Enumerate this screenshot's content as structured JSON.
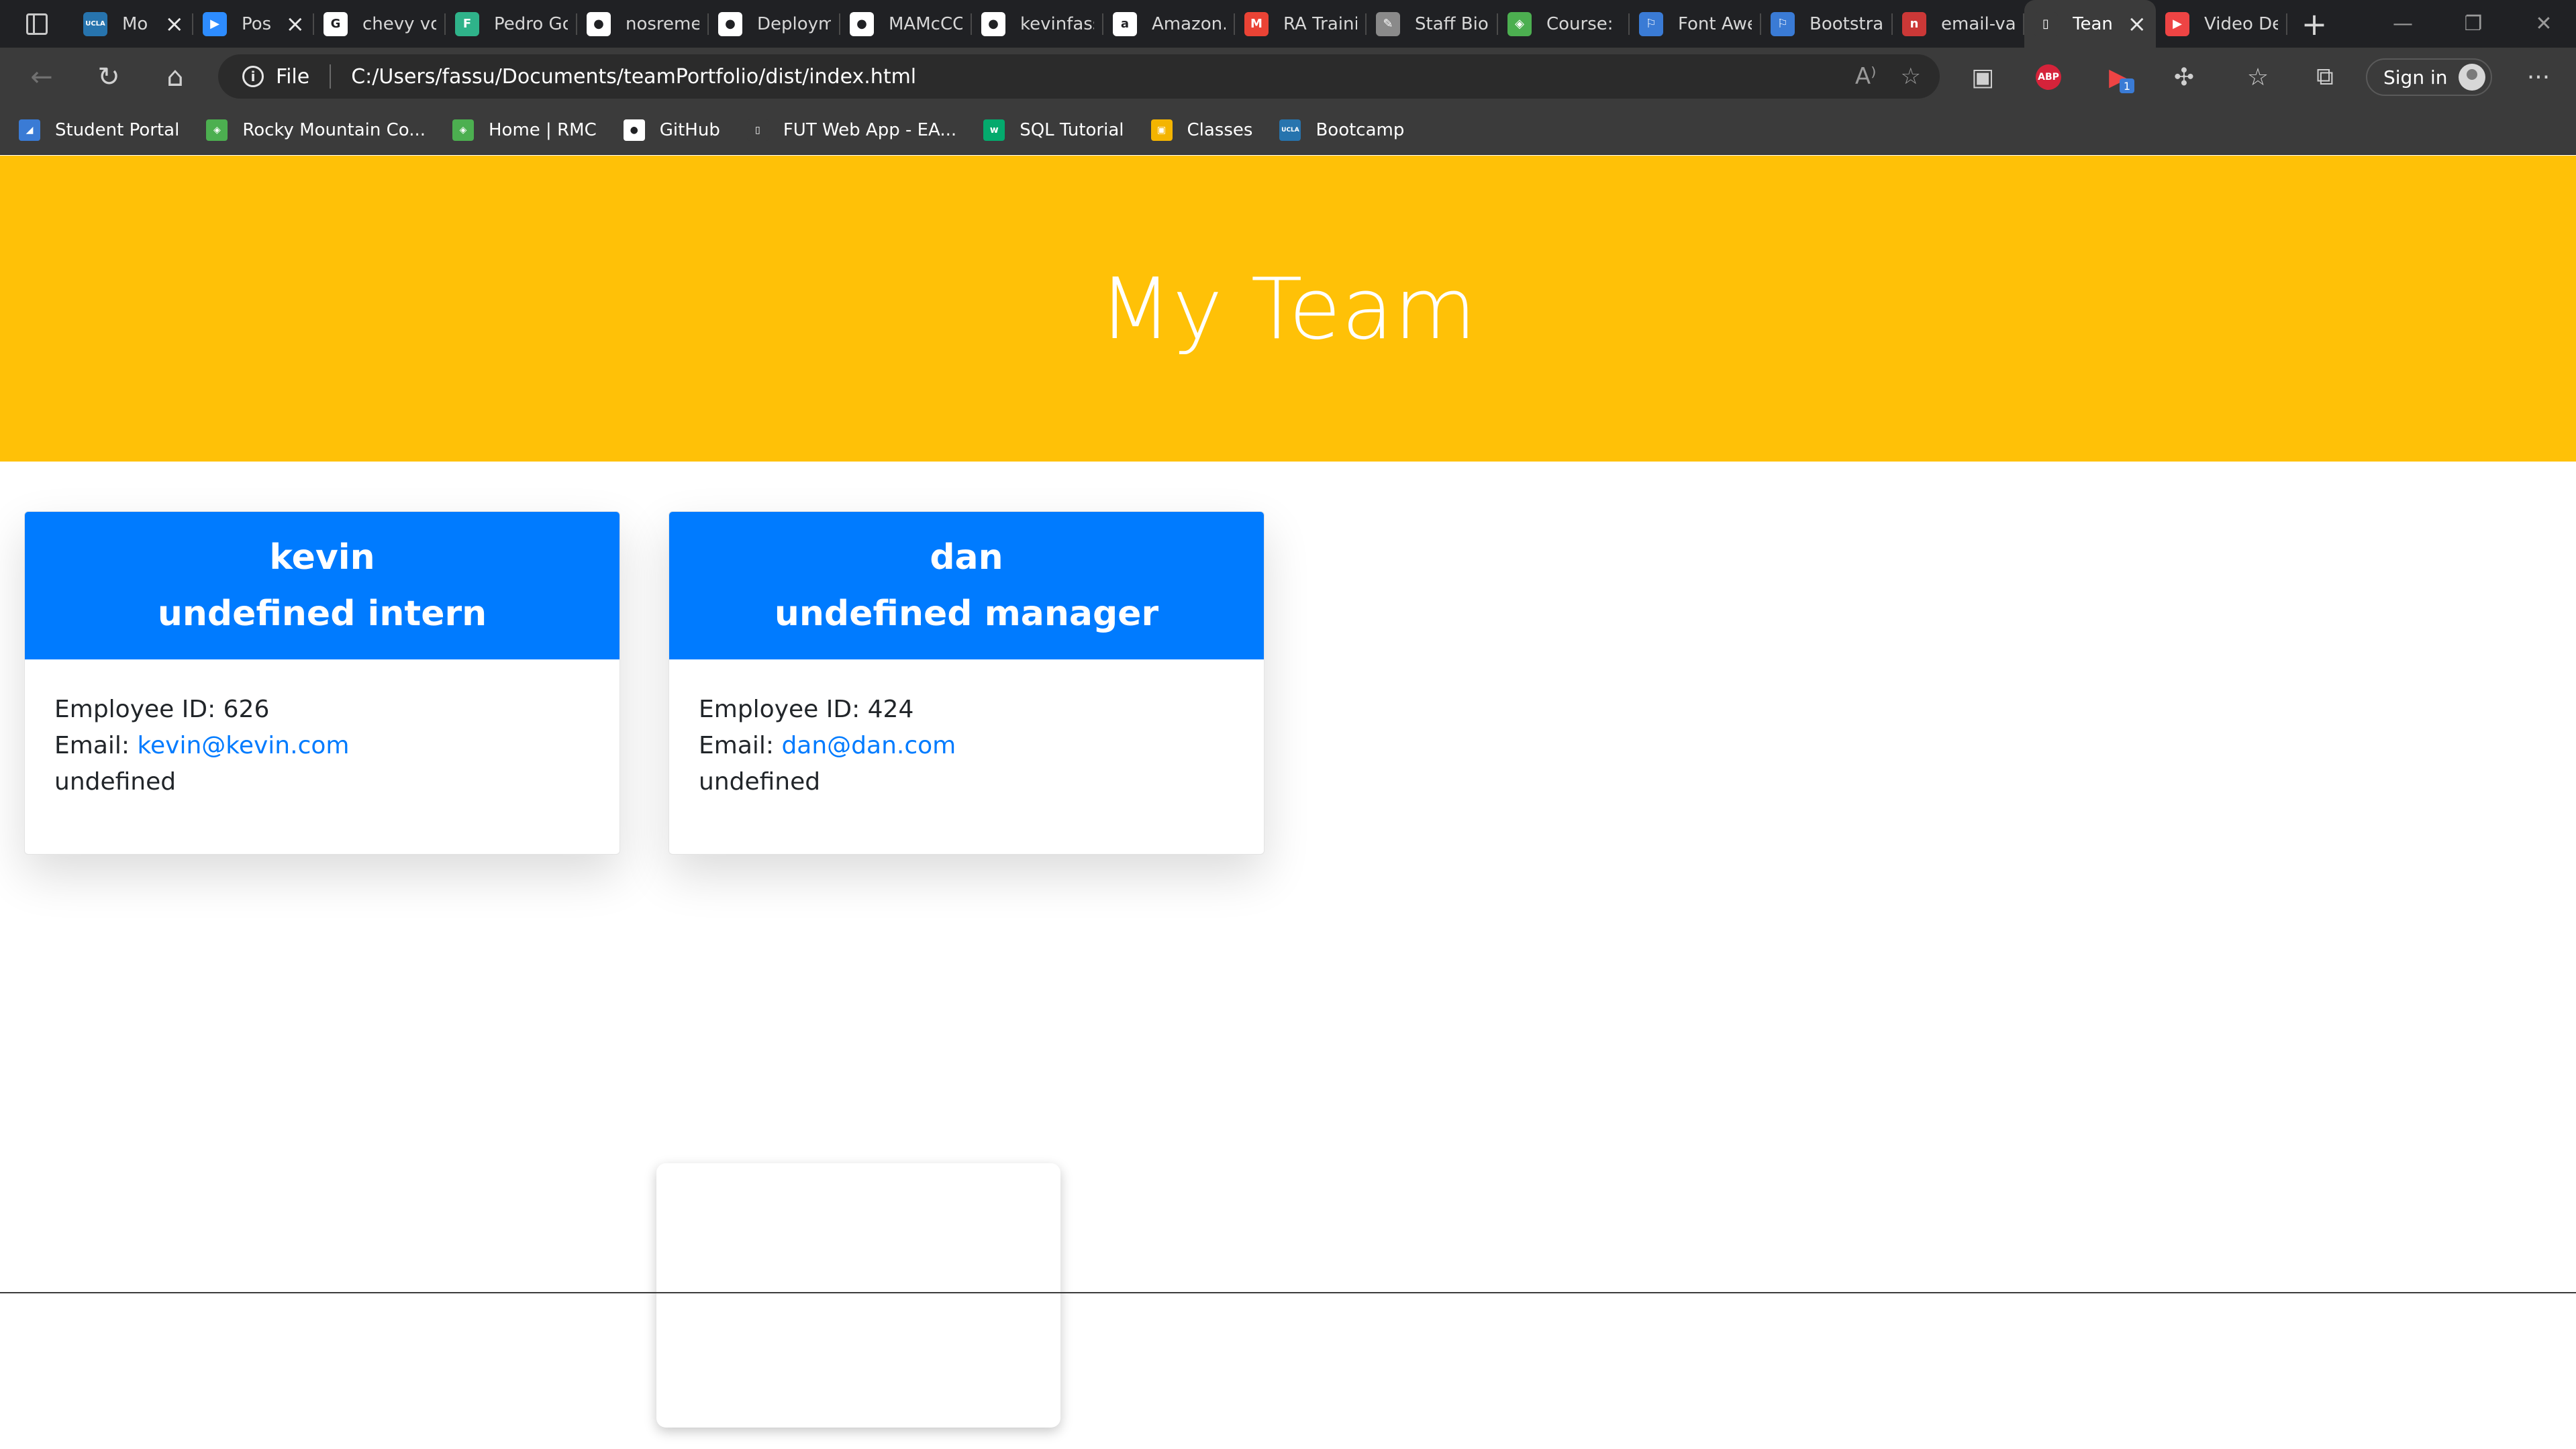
{
  "browser": {
    "tabs": [
      {
        "label": "Mo",
        "favicon": "ucla-icon",
        "color": "#2774ae",
        "glyph": "UCLA",
        "closable": true
      },
      {
        "label": "Pos",
        "favicon": "zoom-icon",
        "color": "#2d8cff",
        "glyph": "▶",
        "closable": true
      },
      {
        "label": "chevy vo",
        "favicon": "google-icon",
        "color": "#ffffff",
        "glyph": "G",
        "closable": false
      },
      {
        "label": "Pedro Go",
        "favicon": "f-icon",
        "color": "#2fb38a",
        "glyph": "F",
        "closable": false
      },
      {
        "label": "nosreme",
        "favicon": "github-icon",
        "color": "#ffffff",
        "glyph": "●",
        "closable": false
      },
      {
        "label": "Deploym",
        "favicon": "github-icon",
        "color": "#ffffff",
        "glyph": "●",
        "closable": false
      },
      {
        "label": "MAMcCC",
        "favicon": "github-icon",
        "color": "#ffffff",
        "glyph": "●",
        "closable": false
      },
      {
        "label": "kevinfass",
        "favicon": "github-icon",
        "color": "#ffffff",
        "glyph": "●",
        "closable": false
      },
      {
        "label": "Amazon.",
        "favicon": "amazon-icon",
        "color": "#ffffff",
        "glyph": "a",
        "closable": false
      },
      {
        "label": "RA Traini",
        "favicon": "gmail-icon",
        "color": "#ea4335",
        "glyph": "M",
        "closable": false
      },
      {
        "label": "Staff Bio",
        "favicon": "pen-icon",
        "color": "#8a8a8a",
        "glyph": "✎",
        "closable": false
      },
      {
        "label": "Course: F",
        "favicon": "shield-icon",
        "color": "#4caf50",
        "glyph": "◈",
        "closable": false
      },
      {
        "label": "Font Awe",
        "favicon": "flag-icon",
        "color": "#3a7bd5",
        "glyph": "⚐",
        "closable": false
      },
      {
        "label": "Bootstrap",
        "favicon": "flag-icon",
        "color": "#3a7bd5",
        "glyph": "⚐",
        "closable": false
      },
      {
        "label": "email-va",
        "favicon": "npm-icon",
        "color": "#cb3837",
        "glyph": "n",
        "closable": false
      },
      {
        "label": "Tean",
        "favicon": "file-icon",
        "color": "#3b3b3b",
        "glyph": "▯",
        "closable": true,
        "active": true
      },
      {
        "label": "Video De",
        "favicon": "video-icon",
        "color": "#e44",
        "glyph": "▶",
        "closable": false
      }
    ],
    "address": {
      "scheme": "File",
      "url": "C:/Users/fassu/Documents/teamPortfolio/dist/index.html"
    },
    "signin_label": "Sign in",
    "abp_label": "ABP",
    "ext_badge": "1",
    "bookmarks": [
      {
        "label": "Student Portal",
        "icon": "portal-icon",
        "color": "#3a7bd5",
        "glyph": "◢"
      },
      {
        "label": "Rocky Mountain Co...",
        "icon": "shield-icon",
        "color": "#4caf50",
        "glyph": "◈"
      },
      {
        "label": "Home | RMC",
        "icon": "shield-icon",
        "color": "#4caf50",
        "glyph": "◈"
      },
      {
        "label": "GitHub",
        "icon": "github-icon",
        "color": "#ffffff",
        "glyph": "●"
      },
      {
        "label": "FUT Web App - EA...",
        "icon": "file-icon",
        "color": "#3b3b3b",
        "glyph": "▯"
      },
      {
        "label": "SQL Tutorial",
        "icon": "w3schools-icon",
        "color": "#04aa6d",
        "glyph": "w"
      },
      {
        "label": "Classes",
        "icon": "classroom-icon",
        "color": "#f4b400",
        "glyph": "▣"
      },
      {
        "label": "Bootcamp",
        "icon": "ucla-icon",
        "color": "#2774ae",
        "glyph": "UCLA"
      }
    ]
  },
  "page": {
    "title": "My Team",
    "employees": [
      {
        "name": "kevin",
        "role": "undefined intern",
        "id_label": "Employee ID: 626",
        "email_prefix": "Email: ",
        "email": "kevin@kevin.com",
        "extra": "undefined"
      },
      {
        "name": "dan",
        "role": "undefined manager",
        "id_label": "Employee ID: 424",
        "email_prefix": "Email: ",
        "email": "dan@dan.com",
        "extra": "undefined"
      }
    ]
  },
  "colors": {
    "jumbotron": "#ffc107",
    "card_header": "#007bff",
    "link": "#007bff"
  }
}
